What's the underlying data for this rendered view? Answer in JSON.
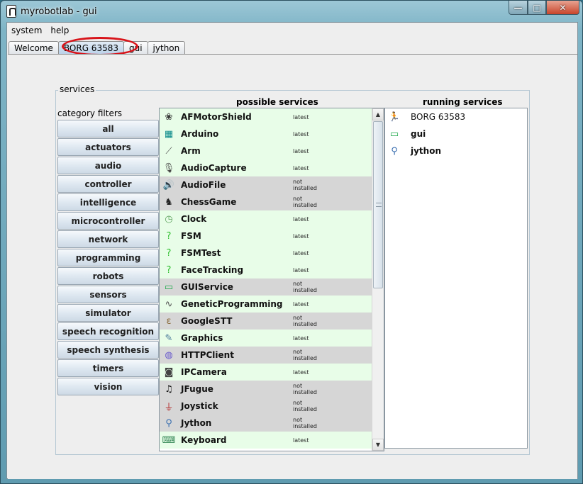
{
  "window": {
    "title": "myrobotlab - gui",
    "controls": {
      "minimize": "—",
      "maximize": "□",
      "close": "✕"
    }
  },
  "menubar": [
    {
      "label": "system"
    },
    {
      "label": "help"
    }
  ],
  "tabs": [
    {
      "label": "Welcome",
      "selected": false
    },
    {
      "label": "BORG 63583",
      "selected": true
    },
    {
      "label": "gui",
      "selected": false
    },
    {
      "label": "jython",
      "selected": false
    }
  ],
  "panel": {
    "legend": "services",
    "category_filters_heading": "category filters",
    "possible_heading": "possible services",
    "running_heading": "running services"
  },
  "categories": [
    "all",
    "actuators",
    "audio",
    "controller",
    "intelligence",
    "microcontroller",
    "network",
    "programming",
    "robots",
    "sensors",
    "simulator",
    "speech recognition",
    "speech synthesis",
    "timers",
    "vision"
  ],
  "possible_services": [
    {
      "name": "AFMotorShield",
      "status": "latest",
      "icon": "adafruit-flower-icon",
      "glyph": "❀",
      "color": "#333333"
    },
    {
      "name": "Arduino",
      "status": "latest",
      "icon": "arduino-board-icon",
      "glyph": "▦",
      "color": "#0a8a8a"
    },
    {
      "name": "Arm",
      "status": "latest",
      "icon": "robot-arm-icon",
      "glyph": "⟋",
      "color": "#555555"
    },
    {
      "name": "AudioCapture",
      "status": "latest",
      "icon": "microphone-icon",
      "glyph": "🎙",
      "color": "#444444"
    },
    {
      "name": "AudioFile",
      "status": "not installed",
      "icon": "speaker-icon",
      "glyph": "🔊",
      "color": "#3aa57a"
    },
    {
      "name": "ChessGame",
      "status": "not installed",
      "icon": "chess-icon",
      "glyph": "♞",
      "color": "#222222"
    },
    {
      "name": "Clock",
      "status": "latest",
      "icon": "clock-icon",
      "glyph": "◷",
      "color": "#5aa05a"
    },
    {
      "name": "FSM",
      "status": "latest",
      "icon": "question-icon",
      "glyph": "?",
      "color": "#2fbf2f"
    },
    {
      "name": "FSMTest",
      "status": "latest",
      "icon": "question-icon",
      "glyph": "?",
      "color": "#2fbf2f"
    },
    {
      "name": "FaceTracking",
      "status": "latest",
      "icon": "question-icon",
      "glyph": "?",
      "color": "#2fbf2f"
    },
    {
      "name": "GUIService",
      "status": "not installed",
      "icon": "monitor-icon",
      "glyph": "▭",
      "color": "#1fa84a"
    },
    {
      "name": "GeneticProgramming",
      "status": "latest",
      "icon": "dna-icon",
      "glyph": "∿",
      "color": "#555555"
    },
    {
      "name": "GoogleSTT",
      "status": "not installed",
      "icon": "ear-icon",
      "glyph": "ε",
      "color": "#8a6a3a"
    },
    {
      "name": "Graphics",
      "status": "latest",
      "icon": "drawing-tools-icon",
      "glyph": "✎",
      "color": "#4a7a9a"
    },
    {
      "name": "HTTPClient",
      "status": "not installed",
      "icon": "http-globe-icon",
      "glyph": "◍",
      "color": "#6a5acd"
    },
    {
      "name": "IPCamera",
      "status": "latest",
      "icon": "camera-icon",
      "glyph": "◙",
      "color": "#444444"
    },
    {
      "name": "JFugue",
      "status": "not installed",
      "icon": "music-note-icon",
      "glyph": "♫",
      "color": "#111111"
    },
    {
      "name": "Joystick",
      "status": "not installed",
      "icon": "joystick-icon",
      "glyph": "⏚",
      "color": "#b02020"
    },
    {
      "name": "Jython",
      "status": "not installed",
      "icon": "python-icon",
      "glyph": "⚲",
      "color": "#3a6fb0"
    },
    {
      "name": "Keyboard",
      "status": "latest",
      "icon": "keyboard-icon",
      "glyph": "⌨",
      "color": "#3a8a5a"
    }
  ],
  "running_services": [
    {
      "name": "BORG 63583",
      "icon": "running-figure-icon",
      "glyph": "🏃",
      "color": "#2a8a3a"
    },
    {
      "name": "gui",
      "icon": "monitor-icon",
      "glyph": "▭",
      "color": "#1fa84a"
    },
    {
      "name": "jython",
      "icon": "python-icon",
      "glyph": "⚲",
      "color": "#3a6fb0"
    }
  ]
}
